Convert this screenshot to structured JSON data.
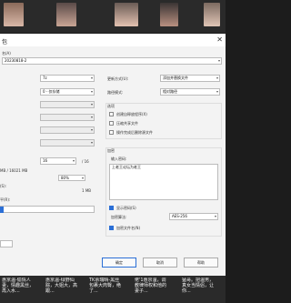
{
  "dialog": {
    "title": "包",
    "archive_name_label": "名(A)",
    "archive_name_value": "20230818-2",
    "format_value": "7z",
    "level_value": "0 - 仅存储",
    "dict_value": "16",
    "dict_unit": "/ 16",
    "memory_text": "MB / 16021 MB",
    "cpu_value": "80%",
    "solid_label": "(S):",
    "solid_value": "1 MB",
    "prm_label": "平(R):",
    "update_mode_label": "更新方式(U):",
    "update_mode_value": "添加并替换文件",
    "path_mode_label": "路径模式:",
    "path_mode_value": "相对路径",
    "options_title": "选项",
    "options": [
      {
        "label": "创建自释放程序(X)",
        "checked": false
      },
      {
        "label": "压缩共享文件",
        "checked": false
      },
      {
        "label": "操作完成后删除源文件",
        "checked": false
      }
    ],
    "encryption_title": "加密",
    "password_label": "输入密码:",
    "password_placeholder": "上老王论坛为老王",
    "show_password_label": "显示密码(S)",
    "method_label": "加密算法:",
    "method_value": "AES-256",
    "encrypt_names_label": "加密文件名(N)",
    "ok_label": "确定",
    "cancel_label": "取消",
    "help_label": "帮助"
  },
  "captions": [
    "惠京温-偷情人妻，情趣黑丝，再入水...",
    "惠京温-绿野仙踪，大姐大，高跟...",
    "TK余瑞晴-黑丝包裹大肉臀，绝了...",
    "佬'1惠京温，调教律师权和他的妻子...",
    "猛哥。把温男，真女当情侣，让你..."
  ],
  "colors": {
    "accent": "#2b6fd6",
    "dialog_bg": "#f3f3f3"
  }
}
